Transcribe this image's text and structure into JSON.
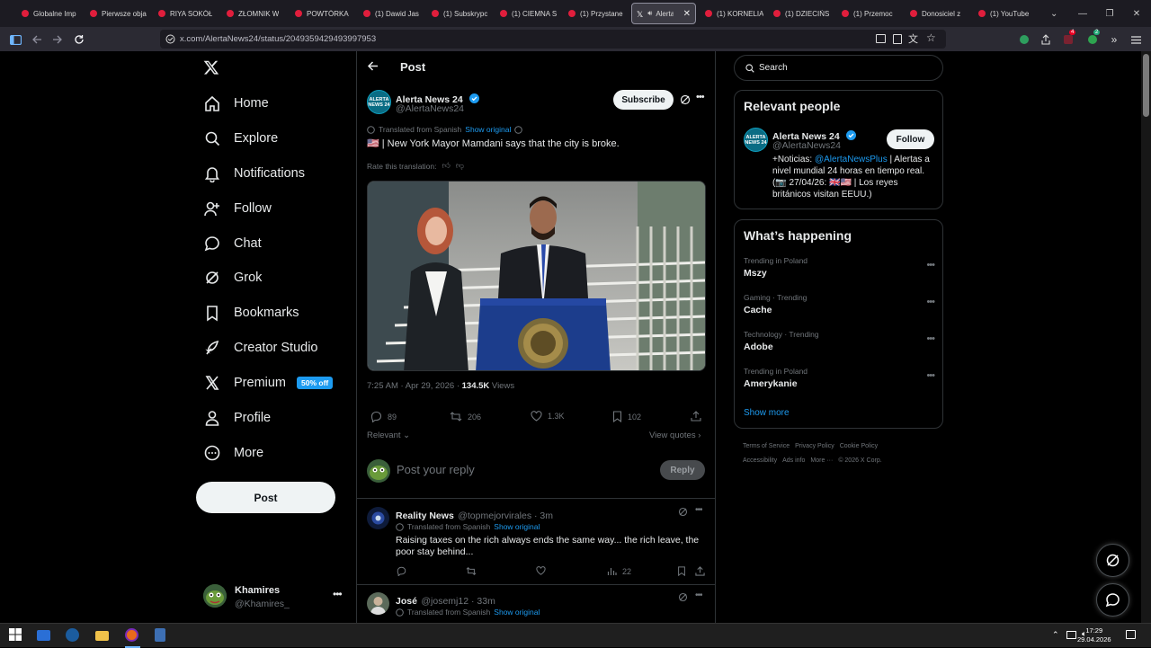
{
  "browser": {
    "tabs": [
      {
        "label": "Globalne Imp"
      },
      {
        "label": "Pierwsze obja"
      },
      {
        "label": "RIYA SOKÓŁ"
      },
      {
        "label": "ZŁOMNIK W"
      },
      {
        "label": "POWTÓRKA"
      },
      {
        "label": "(1) Dawid Jas"
      },
      {
        "label": "(1) Subskrypc"
      },
      {
        "label": "(1) CIEMNA S"
      },
      {
        "label": "(1) Przystane"
      },
      {
        "label": "Alerta",
        "active": true
      },
      {
        "label": "(1) KORNELIA"
      },
      {
        "label": "(1) DZIECIŃS"
      },
      {
        "label": "(1) Przemoc"
      },
      {
        "label": "Donosiciel z"
      },
      {
        "label": "(1) YouTube"
      }
    ],
    "url": "x.com/AlertaNews24/status/2049359429493997953",
    "extension_badge_1": "4",
    "extension_badge_2": "2"
  },
  "left_nav": {
    "items": [
      {
        "label": "Home",
        "icon": "home-icon"
      },
      {
        "label": "Explore",
        "icon": "search-icon"
      },
      {
        "label": "Notifications",
        "icon": "bell-icon"
      },
      {
        "label": "Follow",
        "icon": "person-plus-icon"
      },
      {
        "label": "Chat",
        "icon": "chat-icon"
      },
      {
        "label": "Grok",
        "icon": "grok-icon"
      },
      {
        "label": "Bookmarks",
        "icon": "bookmark-icon"
      },
      {
        "label": "Creator Studio",
        "icon": "rocket-icon"
      },
      {
        "label": "Premium",
        "icon": "x-logo-icon",
        "badge": "50% off"
      },
      {
        "label": "Profile",
        "icon": "person-icon"
      },
      {
        "label": "More",
        "icon": "more-circle-icon"
      }
    ],
    "post_button": "Post",
    "account": {
      "name": "Khamires",
      "handle": "@Khamires_"
    }
  },
  "post": {
    "header_title": "Post",
    "author_name": "Alerta News 24",
    "author_handle": "@AlertaNews24",
    "avatar_text": "ALERTA NEWS 24",
    "subscribe_label": "Subscribe",
    "translated_from": "Translated from Spanish",
    "show_original": "Show original",
    "text": "🇺🇸 | New York Mayor Mamdani says that the city is broke.",
    "rate_translation": "Rate this translation:",
    "timestamp": "7:25 AM · Apr 29, 2026 · ",
    "views_count": "134.5K",
    "views_label": " Views",
    "replies": "89",
    "reposts": "206",
    "likes": "1.3K",
    "bookmarks": "102",
    "sort_label": "Relevant",
    "view_quotes": "View quotes",
    "reply_placeholder": "Post your reply",
    "reply_button": "Reply"
  },
  "replies": [
    {
      "name": "Reality News",
      "handle": "@topmejorvirales · 3m",
      "translated_from": "Translated from Spanish",
      "show_original": "Show original",
      "text": "Raising taxes on the rich always ends the same way... the rich leave, the poor stay behind...",
      "views": "22"
    },
    {
      "name": "José",
      "handle": "@josemj12 · 33m",
      "translated_from": "Translated from Spanish",
      "show_original": "Show original",
      "text": ""
    }
  ],
  "right_col": {
    "search_placeholder": "Search",
    "relevant_title": "Relevant people",
    "person": {
      "name": "Alerta News 24",
      "handle": "@AlertaNews24",
      "follow_label": "Follow",
      "bio_prefix": "+Noticias: ",
      "bio_link": "@AlertaNewsPlus",
      "bio_rest": " | Alertas a nivel mundial 24 horas en tiempo real. (📷 27/04/26: 🇬🇧🇺🇸 | Los reyes británicos visitan EEUU.)"
    },
    "happening_title": "What’s happening",
    "trends": [
      {
        "context": "Trending in Poland",
        "title": "Mszy"
      },
      {
        "context": "Gaming · Trending",
        "title": "Cache"
      },
      {
        "context": "Technology · Trending",
        "title": "Adobe"
      },
      {
        "context": "Trending in Poland",
        "title": "Amerykanie"
      }
    ],
    "show_more": "Show more",
    "footer": [
      "Terms of Service",
      "Privacy Policy",
      "Cookie Policy",
      "Accessibility",
      "Ads info",
      "More ···",
      "© 2026 X Corp."
    ]
  },
  "taskbar": {
    "time": "17:29",
    "date": "29.04.2026"
  },
  "colors": {
    "accent": "#1d9bf0",
    "background": "#000000",
    "border": "#2f3336",
    "muted_text": "#71767b"
  }
}
